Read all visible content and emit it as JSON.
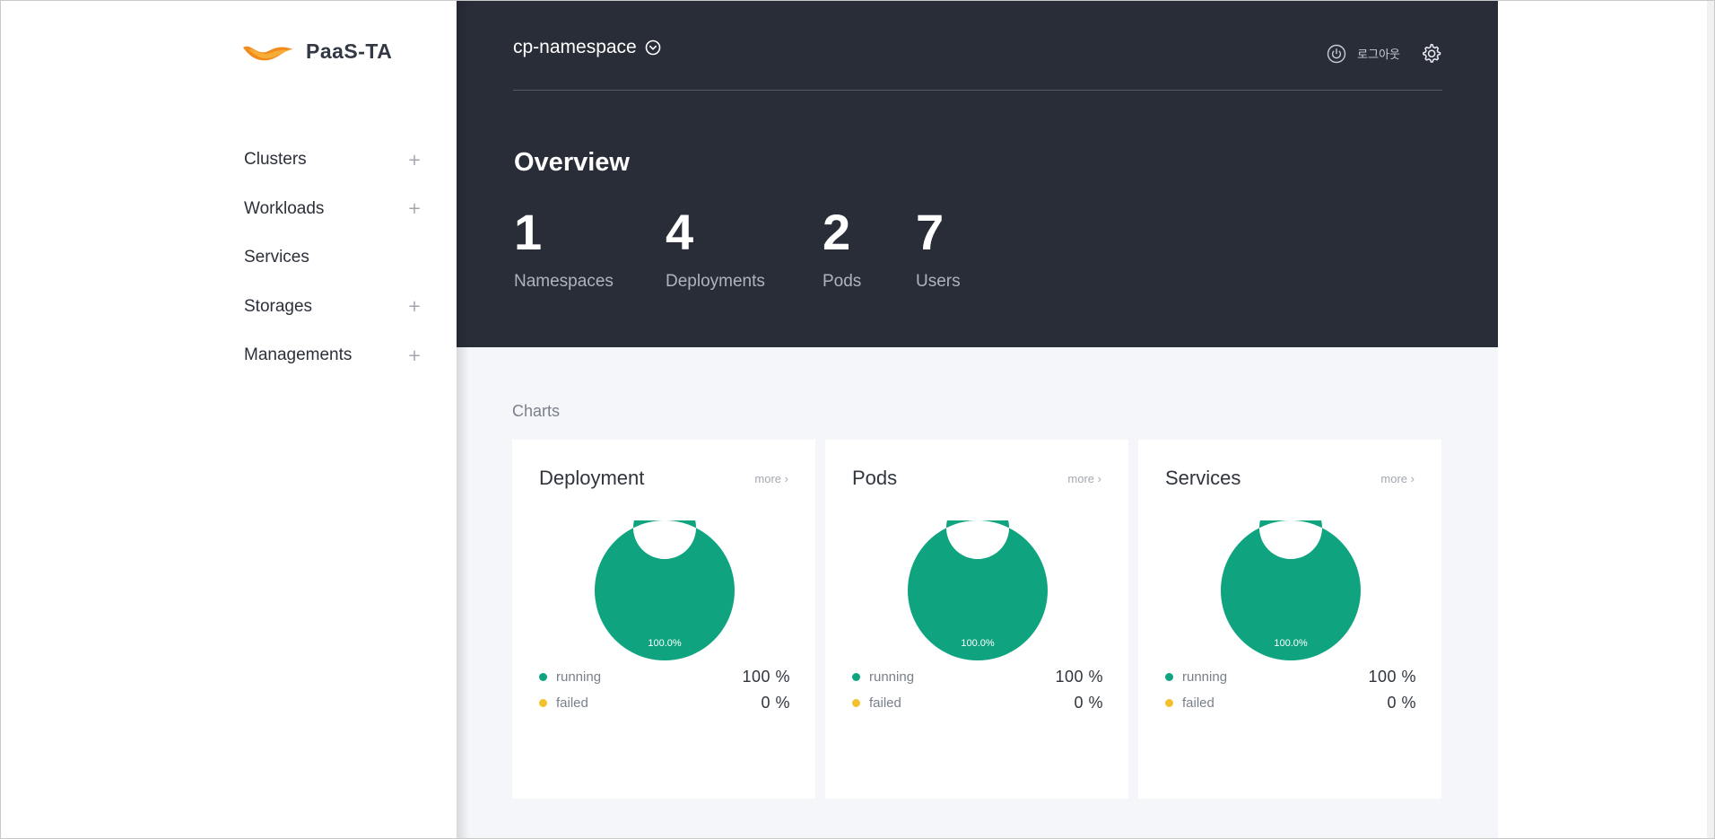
{
  "brand": {
    "logo_text": "PaaS-TA",
    "orange": "#f28a1d",
    "orange_light": "#f7b23a"
  },
  "sidebar": {
    "items": [
      {
        "label": "Clusters",
        "expand_icon": "plus-icon"
      },
      {
        "label": "Workloads",
        "expand_icon": "plus-icon"
      },
      {
        "label": "Services"
      },
      {
        "label": "Storages",
        "expand_icon": "plus-icon"
      },
      {
        "label": "Managements",
        "expand_icon": "plus-icon"
      }
    ]
  },
  "header": {
    "namespace": "cp-namespace",
    "logout_label": "로그아웃",
    "logout_icon": "power-icon",
    "settings_icon": "gear-icon"
  },
  "overview": {
    "title": "Overview",
    "stats": [
      {
        "value": "1",
        "label": "Namespaces"
      },
      {
        "value": "4",
        "label": "Deployments"
      },
      {
        "value": "2",
        "label": "Pods"
      },
      {
        "value": "7",
        "label": "Users"
      }
    ]
  },
  "charts": {
    "heading": "Charts",
    "more_label": "more",
    "running_label": "running",
    "failed_label": "failed"
  },
  "colors": {
    "running": "#0fa47f",
    "failed": "#f5c02d",
    "hero_bg": "#292d38"
  },
  "chart_data": [
    {
      "type": "pie",
      "title": "Deployment",
      "categories": [
        "running",
        "failed"
      ],
      "values": [
        100,
        0
      ],
      "data_labels": [
        "100.0%"
      ],
      "legend": [
        {
          "label": "running",
          "value": "100 %"
        },
        {
          "label": "failed",
          "value": "0 %"
        }
      ]
    },
    {
      "type": "pie",
      "title": "Pods",
      "categories": [
        "running",
        "failed"
      ],
      "values": [
        100,
        0
      ],
      "data_labels": [
        "100.0%"
      ],
      "legend": [
        {
          "label": "running",
          "value": "100 %"
        },
        {
          "label": "failed",
          "value": "0 %"
        }
      ]
    },
    {
      "type": "pie",
      "title": "Services",
      "categories": [
        "running",
        "failed"
      ],
      "values": [
        100,
        0
      ],
      "data_labels": [
        "100.0%"
      ],
      "legend": [
        {
          "label": "running",
          "value": "100 %"
        },
        {
          "label": "failed",
          "value": "0 %"
        }
      ]
    }
  ]
}
